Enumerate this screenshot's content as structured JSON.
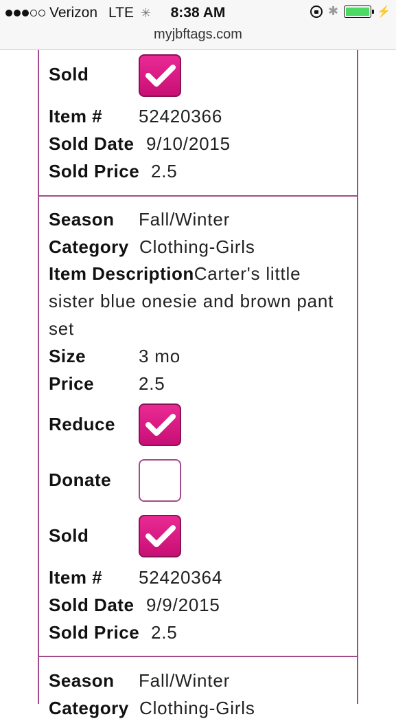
{
  "status_bar": {
    "carrier": "Verizon",
    "network": "LTE",
    "time": "8:38 AM",
    "signal_bars": 3,
    "signal_total": 5,
    "battery_color": "#4cd964"
  },
  "url_bar": {
    "domain": "myjbftags.com"
  },
  "theme": {
    "accent": "#a24a8c",
    "checkbox_pink": "#e0197f"
  },
  "items": [
    {
      "sold_label": "Sold",
      "sold": true,
      "item_no_label": "Item #",
      "item_no": "52420366",
      "sold_date_label": "Sold Date",
      "sold_date": "9/10/2015",
      "sold_price_label": "Sold Price",
      "sold_price": "2.5"
    },
    {
      "season_label": "Season",
      "season": "Fall/Winter",
      "category_label": "Category",
      "category": "Clothing-Girls",
      "description_label": "Item Description",
      "description": "Carter's little sister blue onesie and brown pant set",
      "size_label": "Size",
      "size": "3 mo",
      "price_label": "Price",
      "price": "2.5",
      "reduce_label": "Reduce",
      "reduce": true,
      "donate_label": "Donate",
      "donate": false,
      "sold_label": "Sold",
      "sold": true,
      "item_no_label": "Item #",
      "item_no": "52420364",
      "sold_date_label": "Sold Date",
      "sold_date": "9/9/2015",
      "sold_price_label": "Sold Price",
      "sold_price": "2.5"
    },
    {
      "season_label": "Season",
      "season": "Fall/Winter",
      "category_label": "Category",
      "category": "Clothing-Girls"
    }
  ]
}
